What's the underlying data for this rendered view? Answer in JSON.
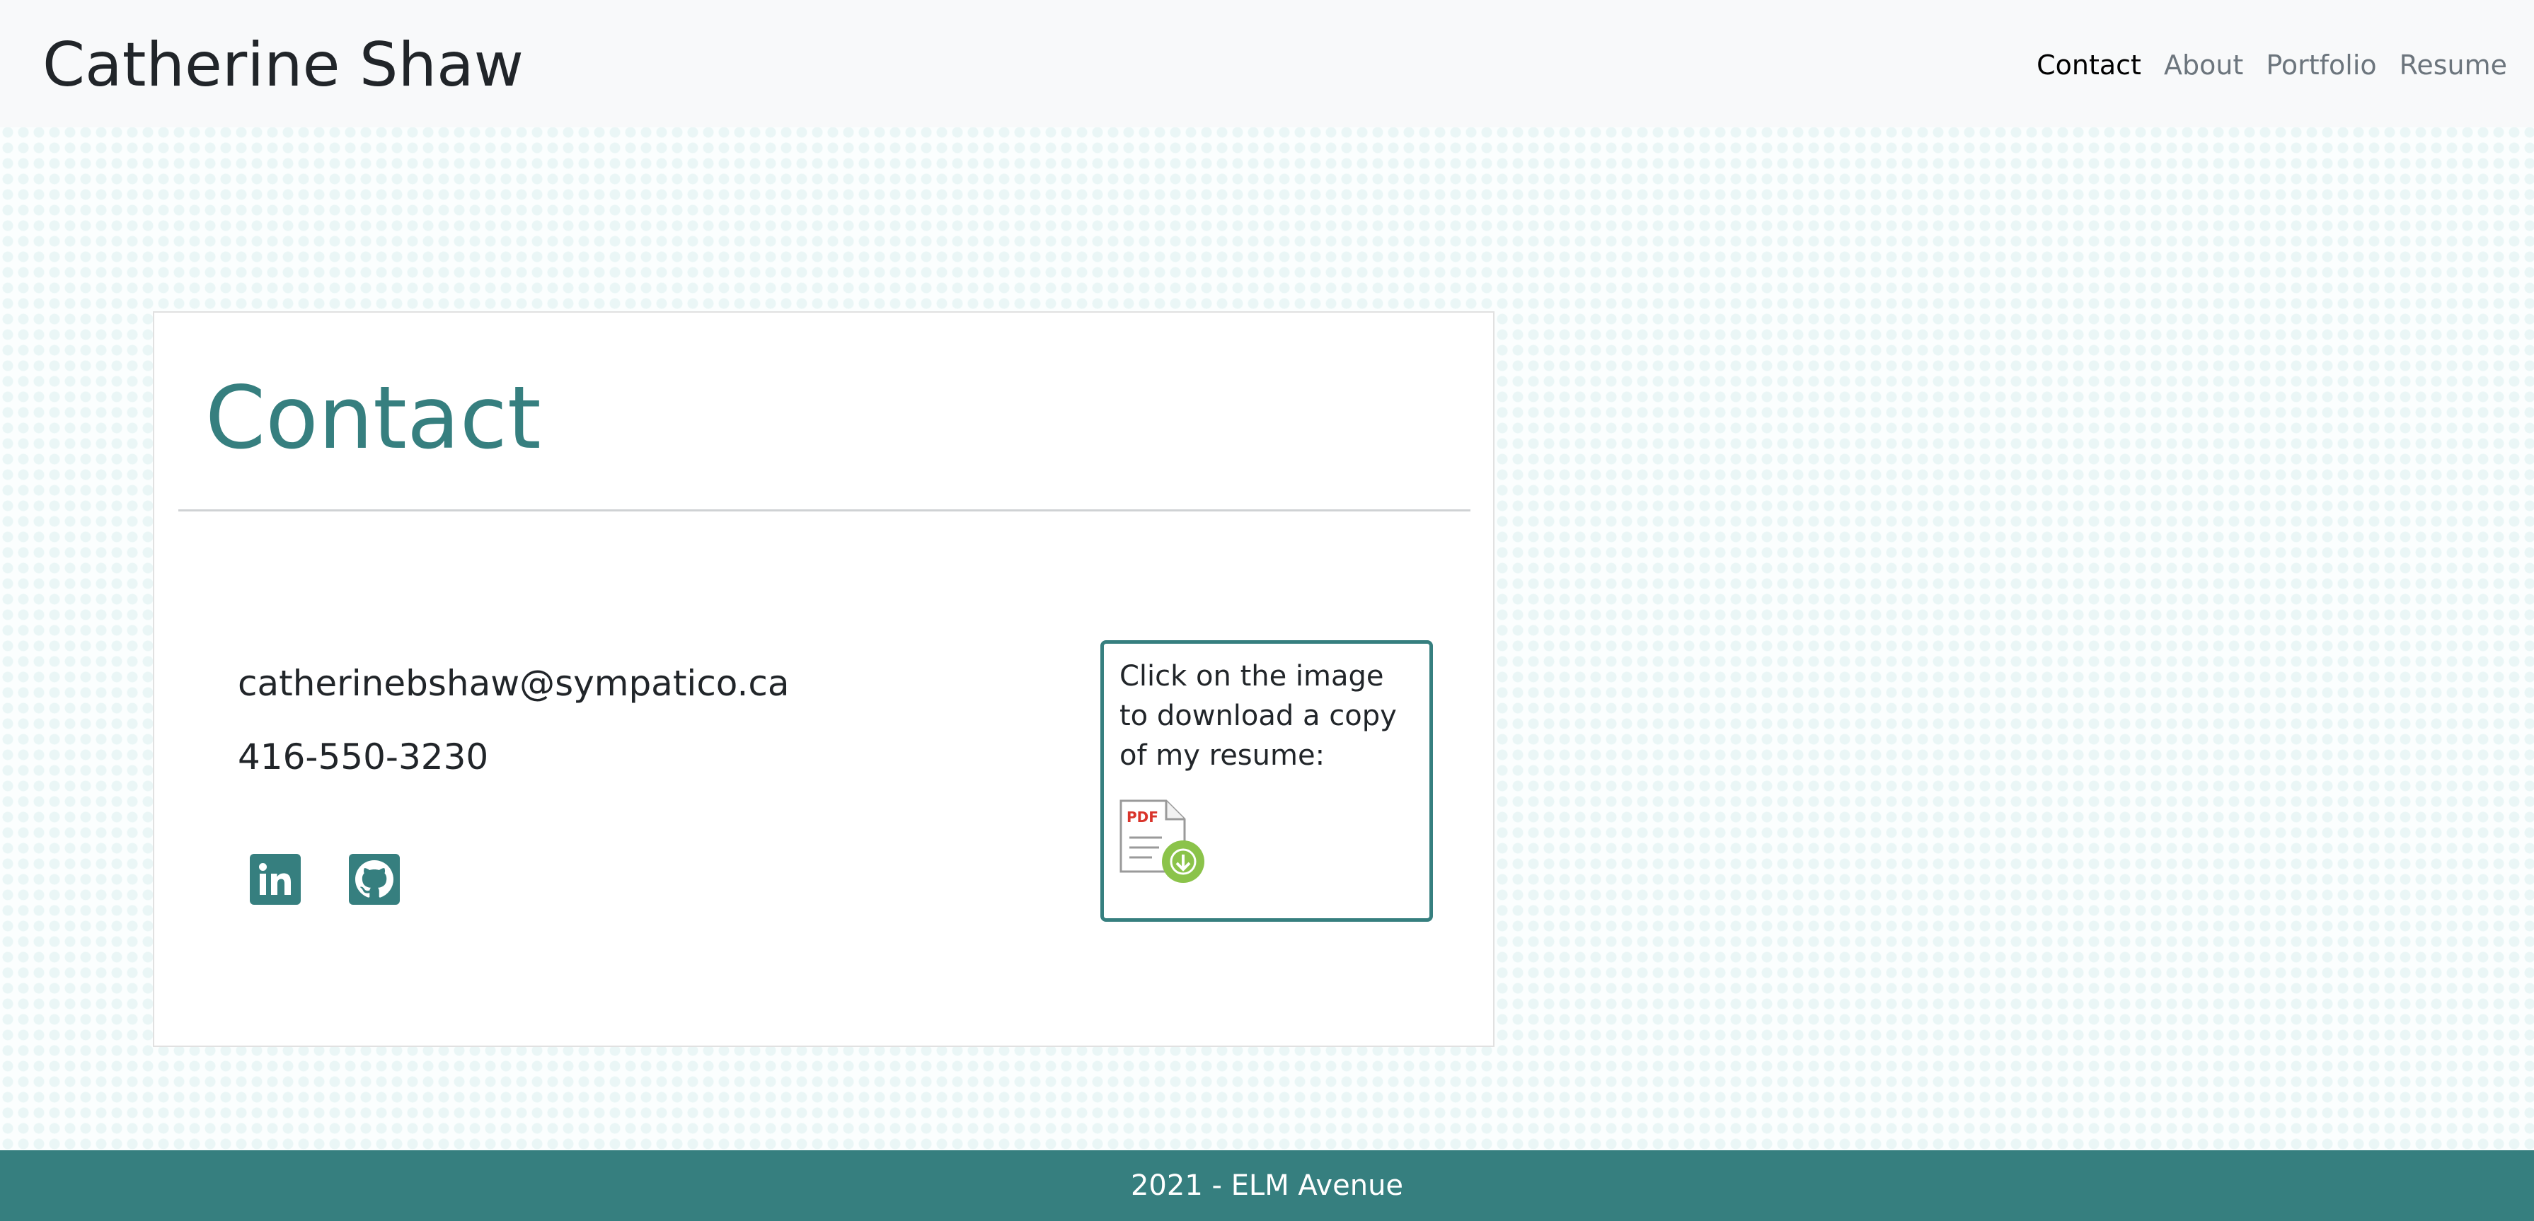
{
  "header": {
    "brand": "Catherine Shaw",
    "nav": [
      {
        "label": "Contact",
        "active": true
      },
      {
        "label": "About",
        "active": false
      },
      {
        "label": "Portfolio",
        "active": false
      },
      {
        "label": "Resume",
        "active": false
      }
    ]
  },
  "contact": {
    "title": "Contact",
    "email": "catherinebshaw@sympatico.ca",
    "phone": "416-550-3230",
    "social": [
      {
        "name": "linkedin",
        "icon": "linkedin-icon"
      },
      {
        "name": "github",
        "icon": "github-icon"
      }
    ]
  },
  "resume": {
    "text": "Click on the image to download a copy of my resume:",
    "icon": "pdf-download-icon",
    "icon_label": "PDF"
  },
  "footer": {
    "text": "2021 - ELM Avenue"
  },
  "colors": {
    "accent": "#367f7f",
    "navbar_bg": "#f8f9fa",
    "text": "#212529",
    "nav_inactive": "#6c757d",
    "pdf_red": "#d9342b",
    "download_green": "#8bc34a"
  }
}
